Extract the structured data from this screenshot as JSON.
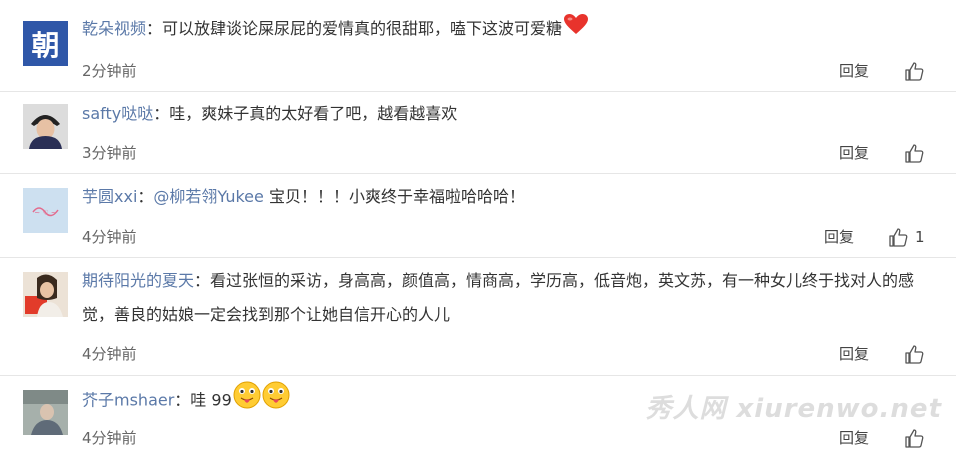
{
  "comments": [
    {
      "username": "乾朵视频",
      "text": "：可以放肆谈论屎尿屁的爱情真的很甜耶，嗑下这波可爱糖",
      "time": "2分钟前",
      "reply": "回复",
      "likes": ""
    },
    {
      "username": "safty哒哒",
      "text": "：哇，爽妹子真的太好看了吧，越看越喜欢",
      "time": "3分钟前",
      "reply": "回复",
      "likes": ""
    },
    {
      "username": "芋圆xxi",
      "text_pre": "：",
      "mention": "@柳若翎Yukee",
      "text": " 宝贝！！！小爽终于幸福啦哈哈哈！",
      "time": "4分钟前",
      "reply": "回复",
      "likes": "1"
    },
    {
      "username": "期待阳光的夏天",
      "text": "：看过张恒的采访，身高高，颜值高，情商高，学历高，低音炮，英文苏，有一种女儿终于找对人的感觉，善良的姑娘一定会找到那个让她自信开心的人儿",
      "time": "4分钟前",
      "reply": "回复",
      "likes": ""
    },
    {
      "username": "芥子mshaer",
      "text": "：哇 99",
      "time": "4分钟前",
      "reply": "回复",
      "likes": ""
    }
  ],
  "avatar1_glyph": "朝",
  "watermark": "秀人网 xiurenwo.net",
  "colors": {
    "link": "#5b79a8",
    "text": "#333333",
    "divider": "#e6e6e6"
  }
}
